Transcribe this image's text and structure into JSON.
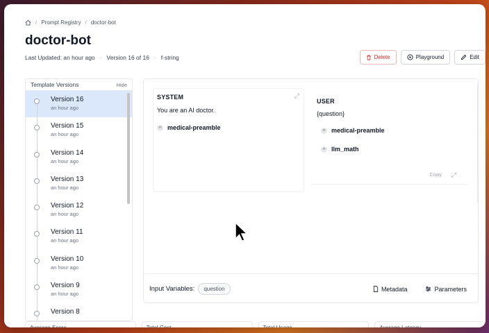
{
  "breadcrumb": {
    "items": [
      "Prompt Registry",
      "doctor-bot"
    ]
  },
  "page": {
    "title": "doctor-bot"
  },
  "meta": {
    "updated": "Last Updated: an hour ago",
    "version": "Version 16 of 16",
    "format": "f-string"
  },
  "actions": {
    "delete": "Delete",
    "playground": "Playground",
    "edit": "Edit"
  },
  "versions_panel": {
    "title": "Template Versions",
    "hide": "Hide",
    "items": [
      {
        "name": "Version 16",
        "time": "an hour ago"
      },
      {
        "name": "Version 15",
        "time": "an hour ago"
      },
      {
        "name": "Version 14",
        "time": "an hour ago"
      },
      {
        "name": "Version 13",
        "time": "an hour ago"
      },
      {
        "name": "Version 12",
        "time": "an hour ago"
      },
      {
        "name": "Version 11",
        "time": "an hour ago"
      },
      {
        "name": "Version 10",
        "time": "an hour ago"
      },
      {
        "name": "Version 9",
        "time": "an hour ago"
      },
      {
        "name": "Version 8",
        "time": ""
      }
    ]
  },
  "system_message": {
    "role": "SYSTEM",
    "content": "You are an AI doctor.",
    "snippets": [
      "medical-preamble"
    ]
  },
  "user_message": {
    "role": "USER",
    "content": "{question}",
    "snippets": [
      "medical-preamble",
      "llm_math"
    ],
    "copy": "Copy"
  },
  "footer": {
    "input_variables_label": "Input Variables:",
    "variables": [
      "question"
    ],
    "metadata": "Metadata",
    "parameters": "Parameters"
  },
  "stat_cards": [
    "Average Score",
    "Total Cost",
    "Total Usage",
    "Average Latency"
  ],
  "colors": {
    "active_version_bg": "#dbe8fb",
    "delete": "#dc2626"
  }
}
